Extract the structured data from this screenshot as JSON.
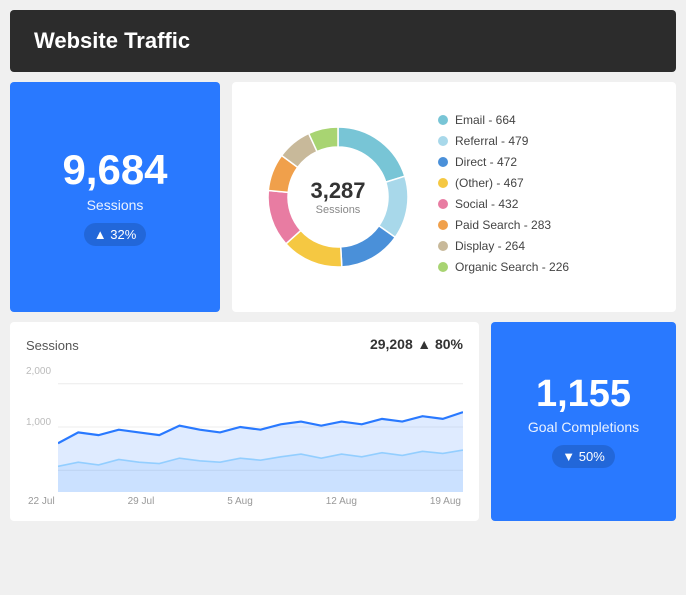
{
  "header": {
    "title": "Website Traffic"
  },
  "sessions_card": {
    "value": "9,684",
    "label": "Sessions",
    "badge": "▲ 32%",
    "badge_color": "up"
  },
  "donut": {
    "center_value": "3,287",
    "center_label": "Sessions",
    "segments": [
      {
        "label": "Email",
        "value": 664,
        "color": "#78c5d6",
        "pct": 20.2
      },
      {
        "label": "Referral",
        "value": 479,
        "color": "#a8d8ea",
        "pct": 14.6
      },
      {
        "label": "Direct",
        "value": 472,
        "color": "#4a90d9",
        "pct": 14.4
      },
      {
        "label": "(Other)",
        "value": 467,
        "color": "#f5c842",
        "pct": 14.2
      },
      {
        "label": "Social",
        "value": 432,
        "color": "#e87ca2",
        "pct": 13.1
      },
      {
        "label": "Paid Search",
        "value": 283,
        "color": "#f0a04b",
        "pct": 8.6
      },
      {
        "label": "Display",
        "value": 264,
        "color": "#c8b99a",
        "pct": 8.0
      },
      {
        "label": "Organic Search",
        "value": 226,
        "color": "#a8d472",
        "pct": 6.9
      }
    ]
  },
  "line_chart": {
    "title": "Sessions",
    "value": "29,208",
    "change": "▲ 80%",
    "y_labels": [
      "2,000",
      "1,000"
    ],
    "x_labels": [
      "22 Jul",
      "29 Jul",
      "5 Aug",
      "12 Aug",
      "19 Aug"
    ]
  },
  "goal_card": {
    "value": "1,155",
    "label": "Goal Completions",
    "badge": "▼ 50%",
    "badge_color": "down"
  }
}
